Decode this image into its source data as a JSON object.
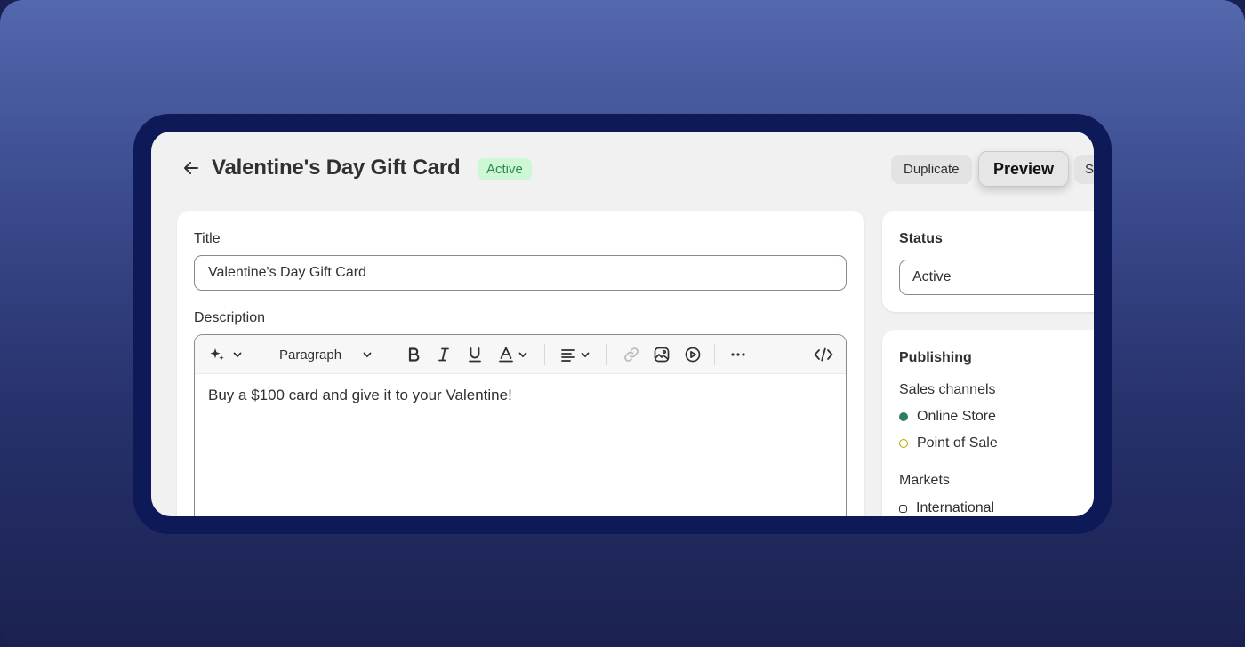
{
  "header": {
    "title": "Valentine's Day Gift Card",
    "status_badge": "Active",
    "actions": {
      "duplicate": "Duplicate",
      "preview": "Preview",
      "more": "S"
    }
  },
  "main": {
    "title_label": "Title",
    "title_value": "Valentine's Day Gift Card",
    "description_label": "Description",
    "toolbar": {
      "paragraph_label": "Paragraph",
      "icons": [
        "magic-icon",
        "chevron-down-icon",
        "bold-icon",
        "italic-icon",
        "underline-icon",
        "text-color-icon",
        "align-icon",
        "link-icon",
        "image-icon",
        "video-icon",
        "more-icon",
        "code-icon"
      ]
    },
    "description_text": "Buy a $100 card and give it to your Valentine!"
  },
  "sidebar": {
    "status": {
      "heading": "Status",
      "selected": "Active"
    },
    "publishing": {
      "heading": "Publishing",
      "sales_channels_label": "Sales channels",
      "channels": [
        {
          "label": "Online Store",
          "state": "active",
          "color": "#2e7d5b"
        },
        {
          "label": "Point of Sale",
          "state": "inactive",
          "color": "#b5a800"
        }
      ],
      "markets_label": "Markets",
      "markets": [
        {
          "label": "International",
          "state": "inactive"
        }
      ]
    }
  },
  "colors": {
    "badge_bg": "#cdf7d5",
    "badge_text": "#2e8a4c",
    "frame": "#0d1a57"
  }
}
